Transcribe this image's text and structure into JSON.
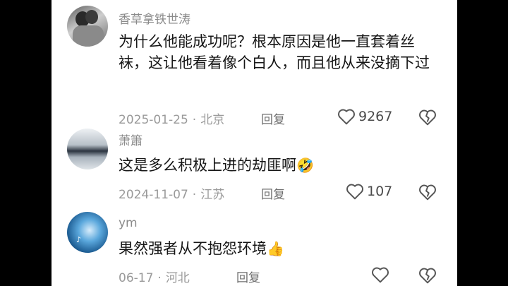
{
  "comments": [
    {
      "username": "香草拿铁世涛",
      "text": "为什么他能成功呢？根本原因是他一直套着丝袜，这让他看着像个白人，而且他从来没摘下过",
      "date": "2025-01-25",
      "location": "北京",
      "reply_label": "回复",
      "likes": "9267",
      "emoji": ""
    },
    {
      "username": "萧簫",
      "text": "这是多么积极上进的劫匪啊",
      "date": "2024-11-07",
      "location": "江苏",
      "reply_label": "回复",
      "likes": "107",
      "emoji": "🤣"
    },
    {
      "username": "ym",
      "text": "果然强者从不抱怨环境",
      "date": "06-17",
      "location": "河北",
      "reply_label": "回复",
      "likes": "",
      "emoji": "👍"
    }
  ],
  "separator": "·",
  "icons": {
    "like": "heart-outline-icon",
    "dislike": "broken-heart-icon"
  },
  "colors": {
    "background": "#000000",
    "panel": "#ffffff",
    "text": "#161616",
    "meta": "#9a9a9a"
  }
}
